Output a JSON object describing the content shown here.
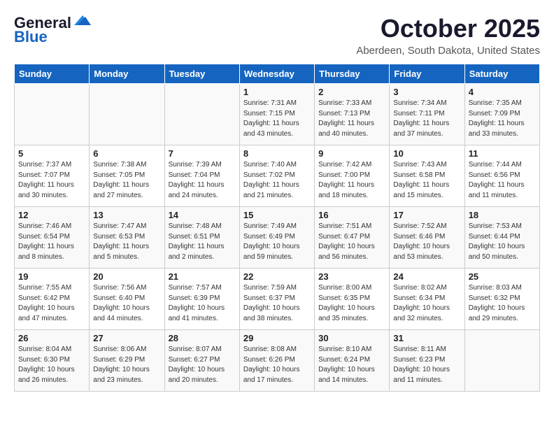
{
  "header": {
    "logo_line1": "General",
    "logo_line2": "Blue",
    "month": "October 2025",
    "location": "Aberdeen, South Dakota, United States"
  },
  "weekdays": [
    "Sunday",
    "Monday",
    "Tuesday",
    "Wednesday",
    "Thursday",
    "Friday",
    "Saturday"
  ],
  "weeks": [
    [
      {
        "day": "",
        "info": ""
      },
      {
        "day": "",
        "info": ""
      },
      {
        "day": "",
        "info": ""
      },
      {
        "day": "1",
        "info": "Sunrise: 7:31 AM\nSunset: 7:15 PM\nDaylight: 11 hours\nand 43 minutes."
      },
      {
        "day": "2",
        "info": "Sunrise: 7:33 AM\nSunset: 7:13 PM\nDaylight: 11 hours\nand 40 minutes."
      },
      {
        "day": "3",
        "info": "Sunrise: 7:34 AM\nSunset: 7:11 PM\nDaylight: 11 hours\nand 37 minutes."
      },
      {
        "day": "4",
        "info": "Sunrise: 7:35 AM\nSunset: 7:09 PM\nDaylight: 11 hours\nand 33 minutes."
      }
    ],
    [
      {
        "day": "5",
        "info": "Sunrise: 7:37 AM\nSunset: 7:07 PM\nDaylight: 11 hours\nand 30 minutes."
      },
      {
        "day": "6",
        "info": "Sunrise: 7:38 AM\nSunset: 7:05 PM\nDaylight: 11 hours\nand 27 minutes."
      },
      {
        "day": "7",
        "info": "Sunrise: 7:39 AM\nSunset: 7:04 PM\nDaylight: 11 hours\nand 24 minutes."
      },
      {
        "day": "8",
        "info": "Sunrise: 7:40 AM\nSunset: 7:02 PM\nDaylight: 11 hours\nand 21 minutes."
      },
      {
        "day": "9",
        "info": "Sunrise: 7:42 AM\nSunset: 7:00 PM\nDaylight: 11 hours\nand 18 minutes."
      },
      {
        "day": "10",
        "info": "Sunrise: 7:43 AM\nSunset: 6:58 PM\nDaylight: 11 hours\nand 15 minutes."
      },
      {
        "day": "11",
        "info": "Sunrise: 7:44 AM\nSunset: 6:56 PM\nDaylight: 11 hours\nand 11 minutes."
      }
    ],
    [
      {
        "day": "12",
        "info": "Sunrise: 7:46 AM\nSunset: 6:54 PM\nDaylight: 11 hours\nand 8 minutes."
      },
      {
        "day": "13",
        "info": "Sunrise: 7:47 AM\nSunset: 6:53 PM\nDaylight: 11 hours\nand 5 minutes."
      },
      {
        "day": "14",
        "info": "Sunrise: 7:48 AM\nSunset: 6:51 PM\nDaylight: 11 hours\nand 2 minutes."
      },
      {
        "day": "15",
        "info": "Sunrise: 7:49 AM\nSunset: 6:49 PM\nDaylight: 10 hours\nand 59 minutes."
      },
      {
        "day": "16",
        "info": "Sunrise: 7:51 AM\nSunset: 6:47 PM\nDaylight: 10 hours\nand 56 minutes."
      },
      {
        "day": "17",
        "info": "Sunrise: 7:52 AM\nSunset: 6:46 PM\nDaylight: 10 hours\nand 53 minutes."
      },
      {
        "day": "18",
        "info": "Sunrise: 7:53 AM\nSunset: 6:44 PM\nDaylight: 10 hours\nand 50 minutes."
      }
    ],
    [
      {
        "day": "19",
        "info": "Sunrise: 7:55 AM\nSunset: 6:42 PM\nDaylight: 10 hours\nand 47 minutes."
      },
      {
        "day": "20",
        "info": "Sunrise: 7:56 AM\nSunset: 6:40 PM\nDaylight: 10 hours\nand 44 minutes."
      },
      {
        "day": "21",
        "info": "Sunrise: 7:57 AM\nSunset: 6:39 PM\nDaylight: 10 hours\nand 41 minutes."
      },
      {
        "day": "22",
        "info": "Sunrise: 7:59 AM\nSunset: 6:37 PM\nDaylight: 10 hours\nand 38 minutes."
      },
      {
        "day": "23",
        "info": "Sunrise: 8:00 AM\nSunset: 6:35 PM\nDaylight: 10 hours\nand 35 minutes."
      },
      {
        "day": "24",
        "info": "Sunrise: 8:02 AM\nSunset: 6:34 PM\nDaylight: 10 hours\nand 32 minutes."
      },
      {
        "day": "25",
        "info": "Sunrise: 8:03 AM\nSunset: 6:32 PM\nDaylight: 10 hours\nand 29 minutes."
      }
    ],
    [
      {
        "day": "26",
        "info": "Sunrise: 8:04 AM\nSunset: 6:30 PM\nDaylight: 10 hours\nand 26 minutes."
      },
      {
        "day": "27",
        "info": "Sunrise: 8:06 AM\nSunset: 6:29 PM\nDaylight: 10 hours\nand 23 minutes."
      },
      {
        "day": "28",
        "info": "Sunrise: 8:07 AM\nSunset: 6:27 PM\nDaylight: 10 hours\nand 20 minutes."
      },
      {
        "day": "29",
        "info": "Sunrise: 8:08 AM\nSunset: 6:26 PM\nDaylight: 10 hours\nand 17 minutes."
      },
      {
        "day": "30",
        "info": "Sunrise: 8:10 AM\nSunset: 6:24 PM\nDaylight: 10 hours\nand 14 minutes."
      },
      {
        "day": "31",
        "info": "Sunrise: 8:11 AM\nSunset: 6:23 PM\nDaylight: 10 hours\nand 11 minutes."
      },
      {
        "day": "",
        "info": ""
      }
    ]
  ]
}
